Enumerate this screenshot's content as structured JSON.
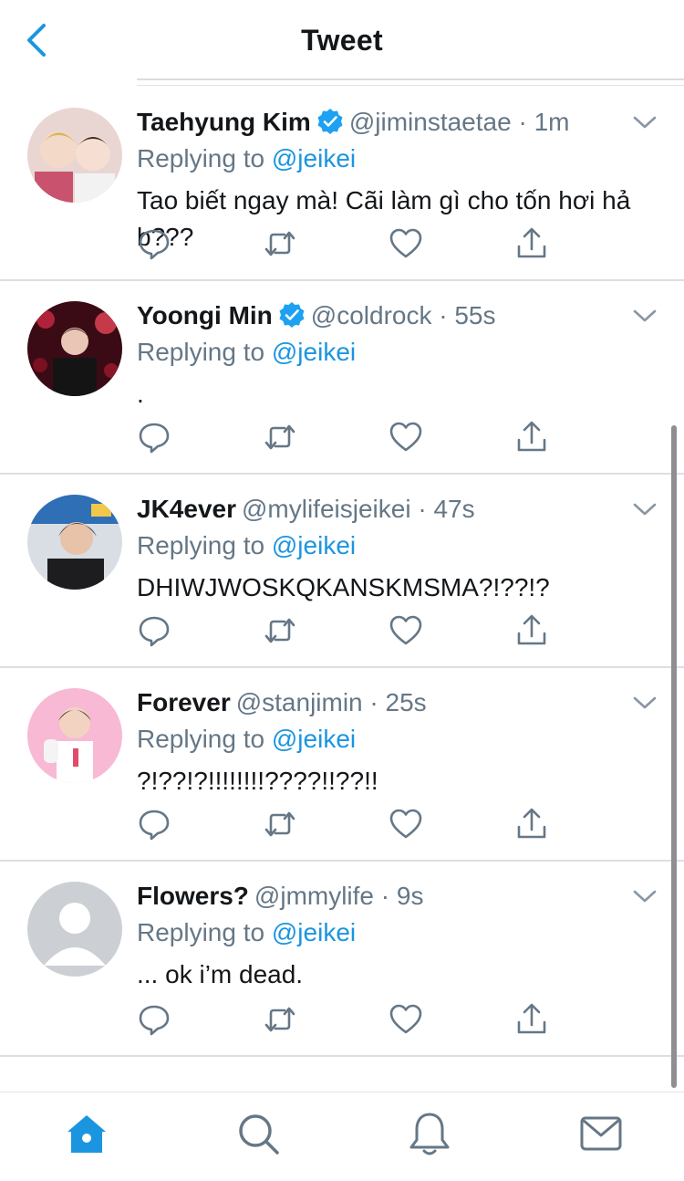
{
  "header": {
    "title": "Tweet"
  },
  "colors": {
    "accent": "#1b95e0",
    "verified": "#1da1f2",
    "secondary_text": "#657786",
    "icon_gray": "#657786"
  },
  "tweets": [
    {
      "name": "Taehyung Kim",
      "verified": true,
      "handle": "@jiminstaetae",
      "sep": " · ",
      "time": "1m",
      "reply_prefix": "Replying to ",
      "reply_to": "@jeikei",
      "text": "Tao biết ngay mà! Cãi làm gì cho tốn hơi hả b???",
      "avatar": "photo-two-people-avatar"
    },
    {
      "name": "Yoongi Min",
      "verified": true,
      "handle": "@coldrock",
      "sep": " · ",
      "time": "55s",
      "reply_prefix": "Replying to ",
      "reply_to": "@jeikei",
      "text": ".",
      "avatar": "photo-concert-avatar"
    },
    {
      "name": "JK4ever",
      "verified": false,
      "handle": "@mylifeisjeikei",
      "sep": " · ",
      "time": "47s",
      "reply_prefix": "Replying to ",
      "reply_to": "@jeikei",
      "text": "DHIWJWOSKQKANSKMSMA?!??!?",
      "avatar": "photo-person-avatar"
    },
    {
      "name": "Forever",
      "verified": false,
      "handle": "@stanjimin",
      "sep": " · ",
      "time": "25s",
      "reply_prefix": "Replying to ",
      "reply_to": "@jeikei",
      "text": "?!??!?!!!!!!!!????!!??!!",
      "avatar": "photo-pink-avatar"
    },
    {
      "name": "Flowers?",
      "verified": false,
      "handle": "@jmmylife",
      "sep": " · ",
      "time": "9s",
      "reply_prefix": "Replying to ",
      "reply_to": "@jeikei",
      "text": "... ok i’m dead.",
      "avatar": "default-avatar"
    }
  ],
  "tabbar": {
    "items": [
      "home-icon",
      "search-icon",
      "notifications-icon",
      "messages-icon"
    ],
    "active": "home-icon"
  }
}
